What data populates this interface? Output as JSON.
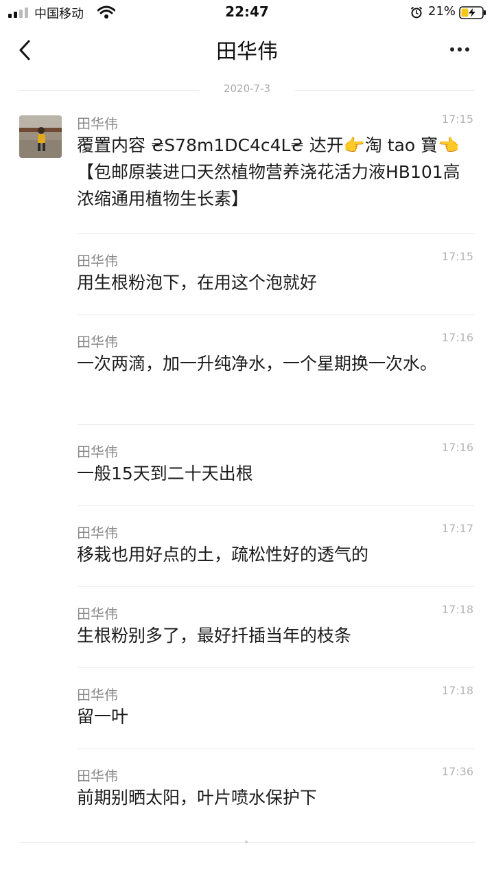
{
  "status_bar": {
    "carrier": "中国移动",
    "time": "22:47",
    "battery_percent": "21%"
  },
  "header": {
    "title": "田华伟"
  },
  "date_divider": "2020-7-3",
  "messages": [
    {
      "sender": "田华伟",
      "time": "17:15",
      "text": "覆置内容 ₴S78m1DC4c4L₴ 达开👉淘 tao 寶👈【包邮原装进口天然植物营养浇花活力液HB101高浓缩通用植物生长素】"
    },
    {
      "sender": "田华伟",
      "time": "17:15",
      "text": "用生根粉泡下，在用这个泡就好"
    },
    {
      "sender": "田华伟",
      "time": "17:16",
      "text": "一次两滴，加一升纯净水，一个星期换一次水。"
    },
    {
      "sender": "田华伟",
      "time": "17:16",
      "text": "一般15天到二十天出根"
    },
    {
      "sender": "田华伟",
      "time": "17:17",
      "text": "移栽也用好点的土，疏松性好的透气的"
    },
    {
      "sender": "田华伟",
      "time": "17:18",
      "text": "生根粉别多了，最好扦插当年的枝条"
    },
    {
      "sender": "田华伟",
      "time": "17:18",
      "text": "留一叶"
    },
    {
      "sender": "田华伟",
      "time": "17:36",
      "text": "前期别晒太阳，叶片喷水保护下"
    }
  ],
  "icons": {
    "back": "chevron-left-icon",
    "more": "more-dots-icon",
    "wifi": "wifi-icon",
    "alarm": "alarm-icon",
    "battery": "battery-charging-icon"
  },
  "colors": {
    "battery_fill": "#f5c518",
    "text_primary": "#1b1b1b",
    "text_secondary": "#8a8a8a"
  }
}
